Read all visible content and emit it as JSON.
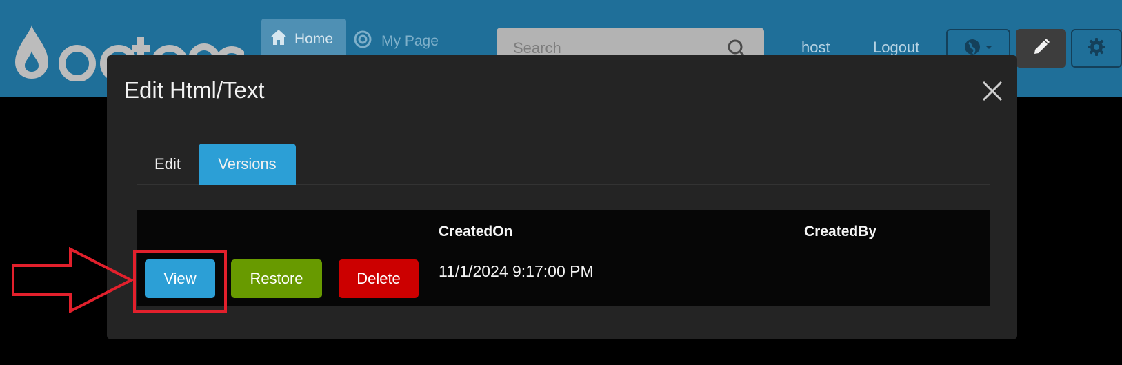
{
  "nav": {
    "home_label": "Home",
    "mypage_label": "My Page",
    "search_placeholder": "Search",
    "user_label": "host",
    "logout_label": "Logout"
  },
  "modal": {
    "title": "Edit Html/Text",
    "tabs": [
      {
        "label": "Edit",
        "active": false
      },
      {
        "label": "Versions",
        "active": true
      }
    ],
    "table": {
      "headers": {
        "created_on": "CreatedOn",
        "created_by": "CreatedBy"
      },
      "rows": [
        {
          "view_label": "View",
          "restore_label": "Restore",
          "delete_label": "Delete",
          "created_on": "11/1/2024 9:17:00 PM",
          "created_by": ""
        }
      ]
    }
  },
  "icons": {
    "home": "home-icon",
    "mypage": "target-icon",
    "search": "search-icon",
    "language": "globe-icon",
    "edit": "pencil-icon",
    "settings": "gear-icon",
    "close": "close-icon",
    "arrow": "right-arrow-annotation"
  },
  "colors": {
    "header_bg": "#1f6f99",
    "modal_bg": "#242424",
    "view_button": "#2c9fd6",
    "restore_button": "#689a00",
    "delete_button": "#cc0000",
    "annotation": "#e2202c"
  }
}
